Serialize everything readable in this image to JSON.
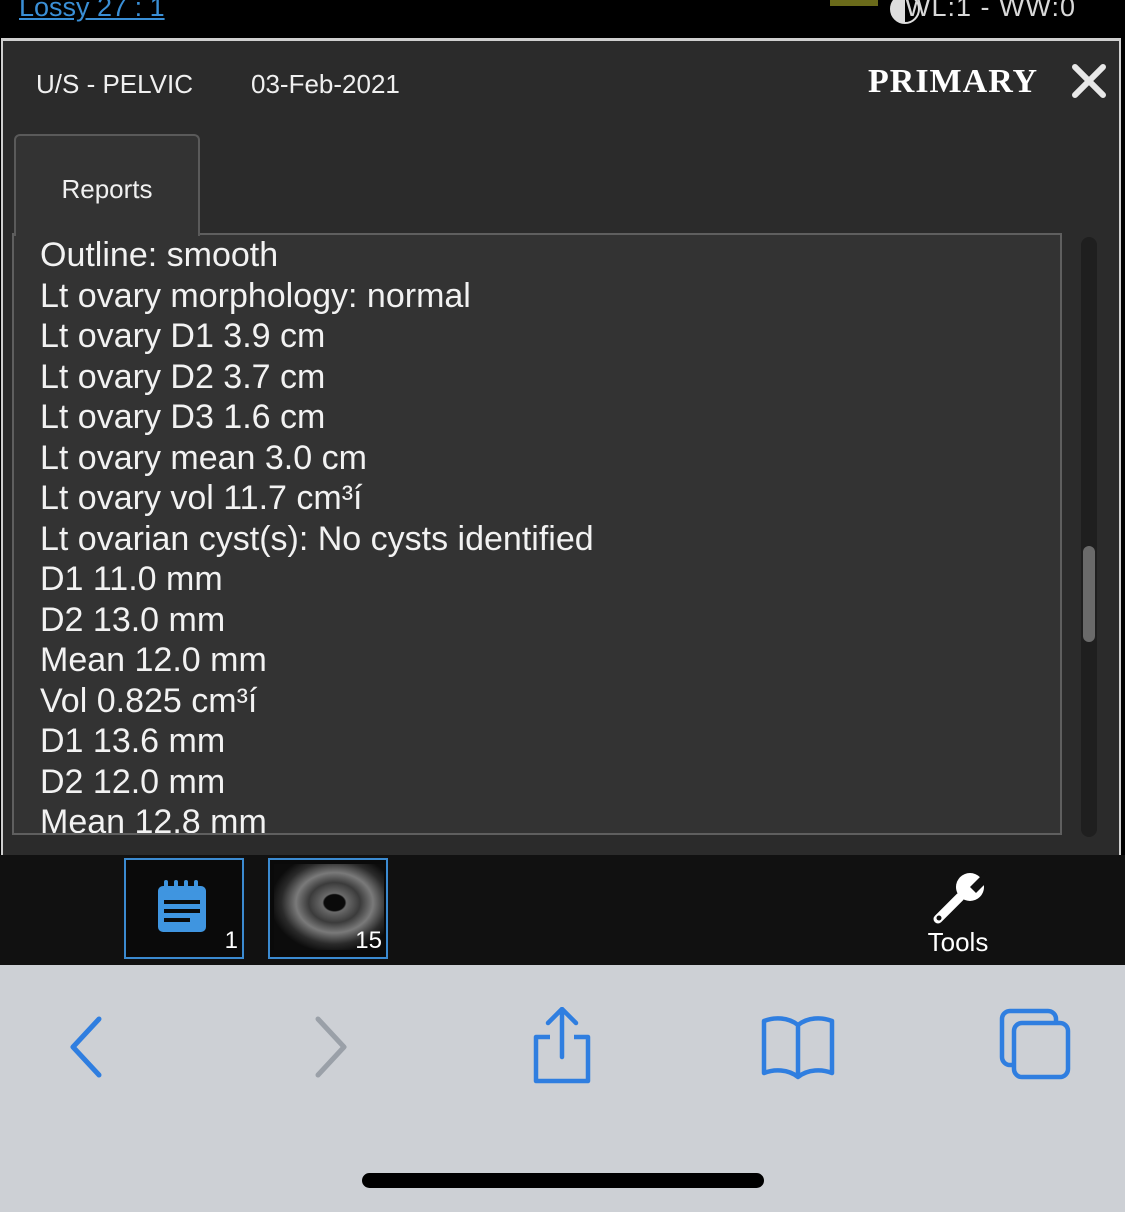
{
  "top": {
    "compression": "Lossy 27 : 1",
    "window_level": "WL:1 - WW:0"
  },
  "header": {
    "study": "U/S - PELVIC",
    "date": "03-Feb-2021",
    "badge": "PRIMARY",
    "close_icon": "close-icon"
  },
  "tabs": [
    {
      "label": "Reports"
    }
  ],
  "report": {
    "lines": [
      "Outline: smooth",
      "Lt ovary morphology: normal",
      "Lt ovary D1 3.9 cm",
      "Lt ovary D2 3.7 cm",
      "Lt ovary D3 1.6 cm",
      "Lt ovary mean 3.0 cm",
      "Lt ovary vol 11.7 cm³í",
      "Lt ovarian cyst(s): No cysts identified",
      "D1 11.0 mm",
      "D2 13.0 mm",
      "Mean 12.0 mm",
      "Vol 0.825 cm³í",
      "D1 13.6 mm",
      "D2 12.0 mm",
      "Mean 12.8 mm"
    ]
  },
  "thumbnails": [
    {
      "icon": "report-notepad-icon",
      "count": "1"
    },
    {
      "icon": "ultrasound-image",
      "count": "15"
    }
  ],
  "tools": {
    "label": "Tools",
    "icon": "wrench-icon"
  },
  "browser": {
    "buttons": [
      "back-icon",
      "forward-icon",
      "share-icon",
      "bookmarks-icon",
      "tabs-icon"
    ],
    "accent": "#2f7ee0",
    "disabled": "#9aa0a8"
  }
}
